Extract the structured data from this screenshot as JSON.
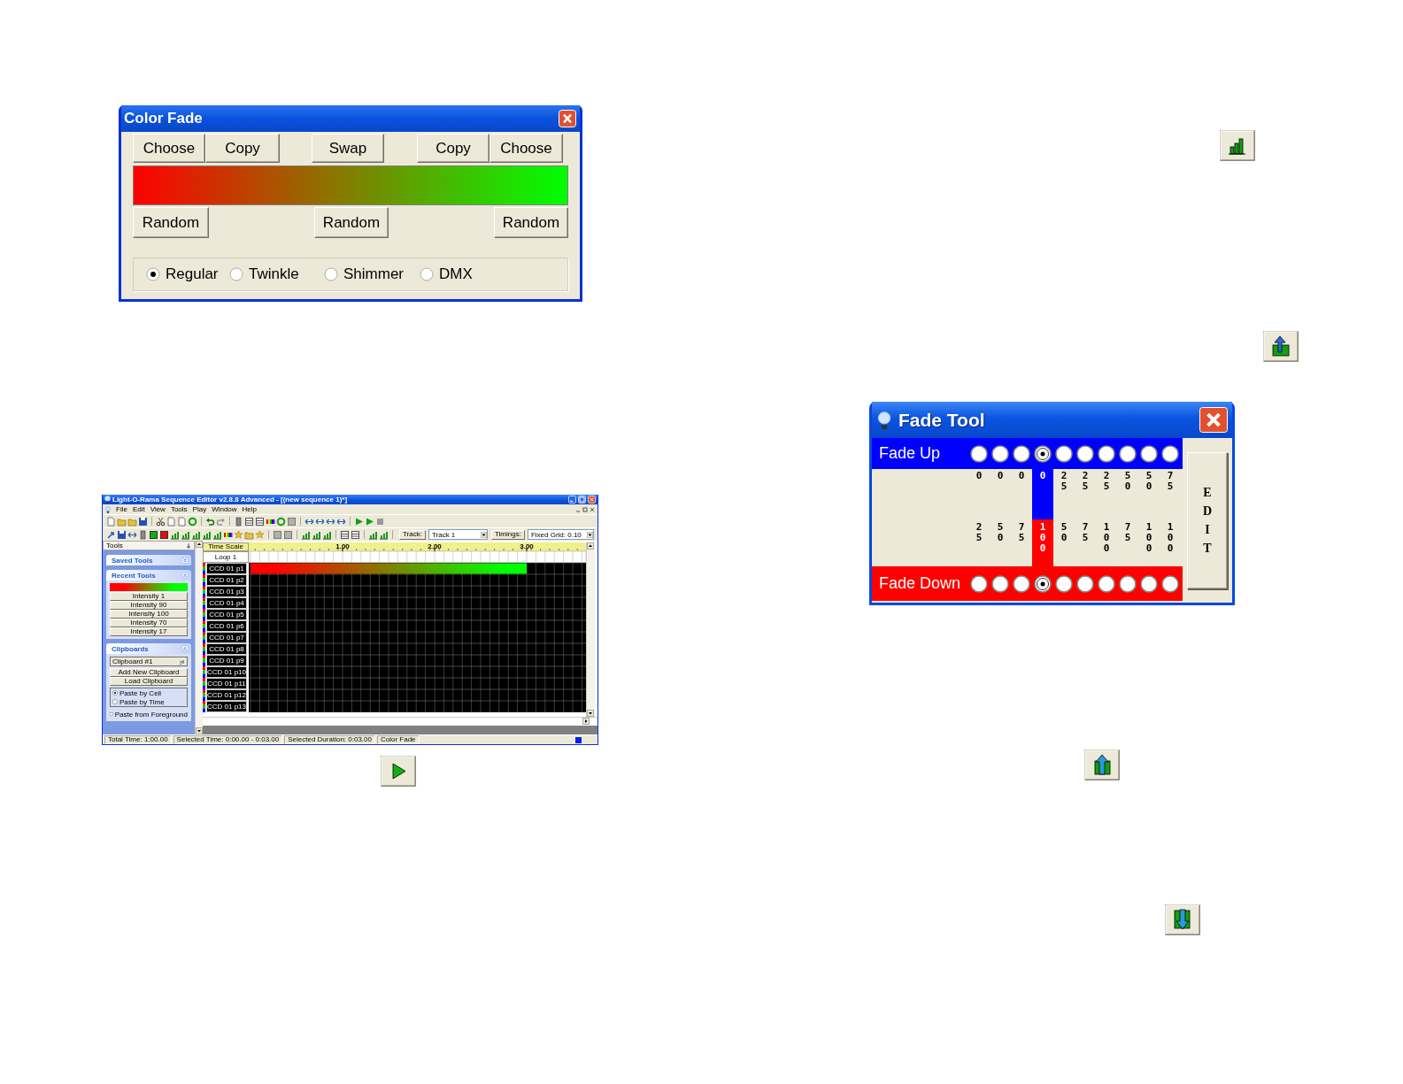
{
  "color_fade": {
    "title": "Color Fade",
    "top_buttons": [
      "Choose",
      "Copy",
      "Swap",
      "Copy",
      "Choose"
    ],
    "colors": [
      {
        "color": "#ff0000"
      },
      {
        "color": "#00ff00"
      }
    ],
    "random_buttons": [
      "Random",
      "Random",
      "Random"
    ],
    "modes": [
      {
        "label": "Regular",
        "selected": true
      },
      {
        "label": "Twinkle",
        "selected": false
      },
      {
        "label": "Shimmer",
        "selected": false
      },
      {
        "label": "DMX",
        "selected": false
      }
    ]
  },
  "sequence_editor": {
    "title": "Light-O-Rama Sequence Editor v2.8.8 Advanced - [(new sequence 1)*]",
    "menu": [
      "File",
      "Edit",
      "View",
      "Tools",
      "Play",
      "Window",
      "Help"
    ],
    "track_label": "Track:",
    "track": "Track 1",
    "timings_label": "Timings:",
    "timing": "Fixed Grid: 0.10",
    "tools_title": "Tools",
    "saved_tools": {
      "title": "Saved Tools",
      "expanded": false
    },
    "recent_tools": {
      "title": "Recent Tools",
      "expanded": true,
      "items": [
        {
          "kind": "swatch",
          "colors": [
            {
              "color": "#ff0000"
            },
            {
              "color": "#00ff00"
            }
          ]
        },
        {
          "kind": "tool",
          "label": "Intensity 1"
        },
        {
          "kind": "tool",
          "label": "Intensity 90"
        },
        {
          "kind": "tool",
          "label": "Intensity 100"
        },
        {
          "kind": "tool",
          "label": "Intensity 70"
        },
        {
          "kind": "tool",
          "label": "Intensity 17"
        }
      ]
    },
    "clipboards": {
      "title": "Clipboards",
      "expanded": true,
      "clipboard": "Clipboard #1",
      "buttons": [
        "Add New Clipboard",
        "Load Clipboard"
      ],
      "paste_modes": [
        {
          "label": "Paste by Cell",
          "selected": true
        },
        {
          "label": "Paste by Time",
          "selected": false
        }
      ],
      "paste_from_foreground": {
        "label": "Paste from Foreground",
        "checked": false
      }
    },
    "time_scale": "Time Scale",
    "ruler_ticks": [
      "1.00",
      "2.00",
      "3.00"
    ],
    "loop": "Loop 1",
    "channels": [
      "CCD 01 p1",
      "CCD 01 p2",
      "CCD 01 p3",
      "CCD 01 p4",
      "CCD 01 p5",
      "CCD 01 p6",
      "CCD 01 p7",
      "CCD 01 p8",
      "CCD 01 p9",
      "CCD 01 p10",
      "CCD 01 p11",
      "CCD 01 p12",
      "CCD 01 p13"
    ],
    "fade_effect": {
      "colors": [
        {
          "color": "#ff0000"
        },
        {
          "color": "#00ff00"
        }
      ]
    },
    "status_bar": [
      "Total Time: 1:00.00",
      "Selected Time: 0:00.00 - 0:03.00",
      "Selected Duration: 0:03.00",
      "Color Fade"
    ]
  },
  "fade_tool": {
    "title": "Fade Tool",
    "fade_up": {
      "label": "Fade Up",
      "options": [
        {
          "value": "0",
          "selected": false
        },
        {
          "value": "0",
          "selected": false
        },
        {
          "value": "0",
          "selected": false
        },
        {
          "value": "0",
          "selected": true
        },
        {
          "value": "25",
          "selected": false
        },
        {
          "value": "25",
          "selected": false
        },
        {
          "value": "25",
          "selected": false
        },
        {
          "value": "50",
          "selected": false
        },
        {
          "value": "50",
          "selected": false
        },
        {
          "value": "75",
          "selected": false
        }
      ]
    },
    "fade_down": {
      "label": "Fade Down",
      "options": [
        {
          "value": "25",
          "selected": false
        },
        {
          "value": "50",
          "selected": false
        },
        {
          "value": "75",
          "selected": false
        },
        {
          "value": "100",
          "selected": true
        },
        {
          "value": "50",
          "selected": false
        },
        {
          "value": "75",
          "selected": false
        },
        {
          "value": "100",
          "selected": false
        },
        {
          "value": "75",
          "selected": false
        },
        {
          "value": "100",
          "selected": false
        },
        {
          "value": "100",
          "selected": false
        }
      ]
    },
    "edit": "EDIT"
  }
}
